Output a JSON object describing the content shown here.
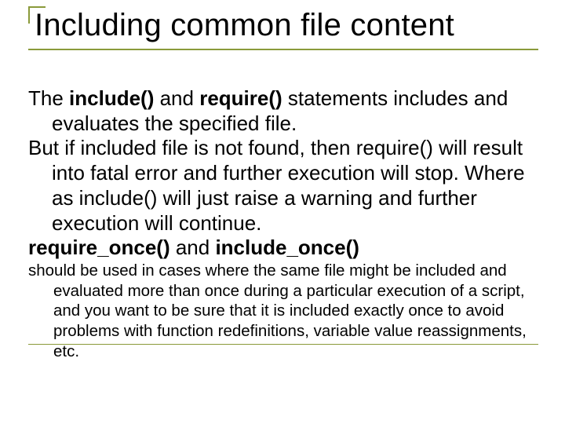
{
  "title": "Including common file content",
  "para1_a": "The ",
  "para1_b": "include()",
  "para1_c": " and ",
  "para1_d": "require()",
  "para1_e": " statements includes and evaluates the specified file.",
  "para2": "But if included file is not found, then require() will result into fatal error and further execution will stop. Where as include() will just raise a warning and further execution will continue.",
  "para3_a": "require_once()",
  "para3_b": " and ",
  "para3_c": "include_once()",
  "para4": "should be used in cases where the same file might be included and evaluated more than once during a particular execution of a script, and you want to be sure that it is included exactly once to avoid problems with function redefinitions, variable value reassignments, etc."
}
